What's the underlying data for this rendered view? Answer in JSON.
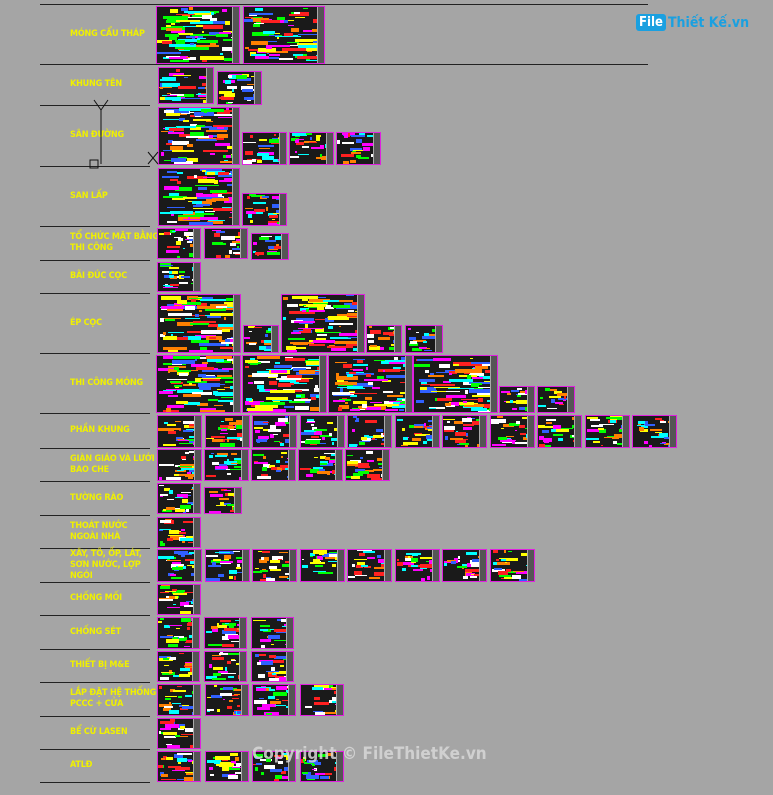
{
  "logo": {
    "box": "File",
    "text": "Thiết Kế.vn"
  },
  "watermark": "Copyright © FileThietKe.vn",
  "rows": [
    {
      "label": "MÓNG CẨU THÁP"
    },
    {
      "label": "KHUNG TÊN"
    },
    {
      "label": "SÂN ĐƯỜNG"
    },
    {
      "label": "SAN LẤP"
    },
    {
      "label": "TỔ CHỨC MẶT BẰNG\nTHI CÔNG"
    },
    {
      "label": "BÃI ĐÚC CỌC"
    },
    {
      "label": "ÉP CỌC"
    },
    {
      "label": "THI CÔNG MÓNG"
    },
    {
      "label": "PHẦN KHUNG"
    },
    {
      "label": "GIÀN GIÁO VÀ LƯỚI\nBAO CHE"
    },
    {
      "label": "TƯỜNG RÀO"
    },
    {
      "label": "THOÁT NƯỚC\nNGOÀI NHÀ"
    },
    {
      "label": "XÂY, TÔ, ỐP, LÁT,\nSƠN NƯỚC, LỢP\nNGÓI"
    },
    {
      "label": "CHỐNG MỐI"
    },
    {
      "label": "CHỐNG SÉT"
    },
    {
      "label": "THIẾT BỊ M&E"
    },
    {
      "label": "LẮP ĐẶT HỆ THỐNG\nPCCC + CỬA"
    },
    {
      "label": "BỂ CỪ LASEN"
    },
    {
      "label": "ATLĐ"
    }
  ],
  "colors": {
    "background": "#a5a5a5",
    "label": "#f0f000",
    "sheet_border": "#e020e0",
    "logo": "#1aa0e0"
  }
}
